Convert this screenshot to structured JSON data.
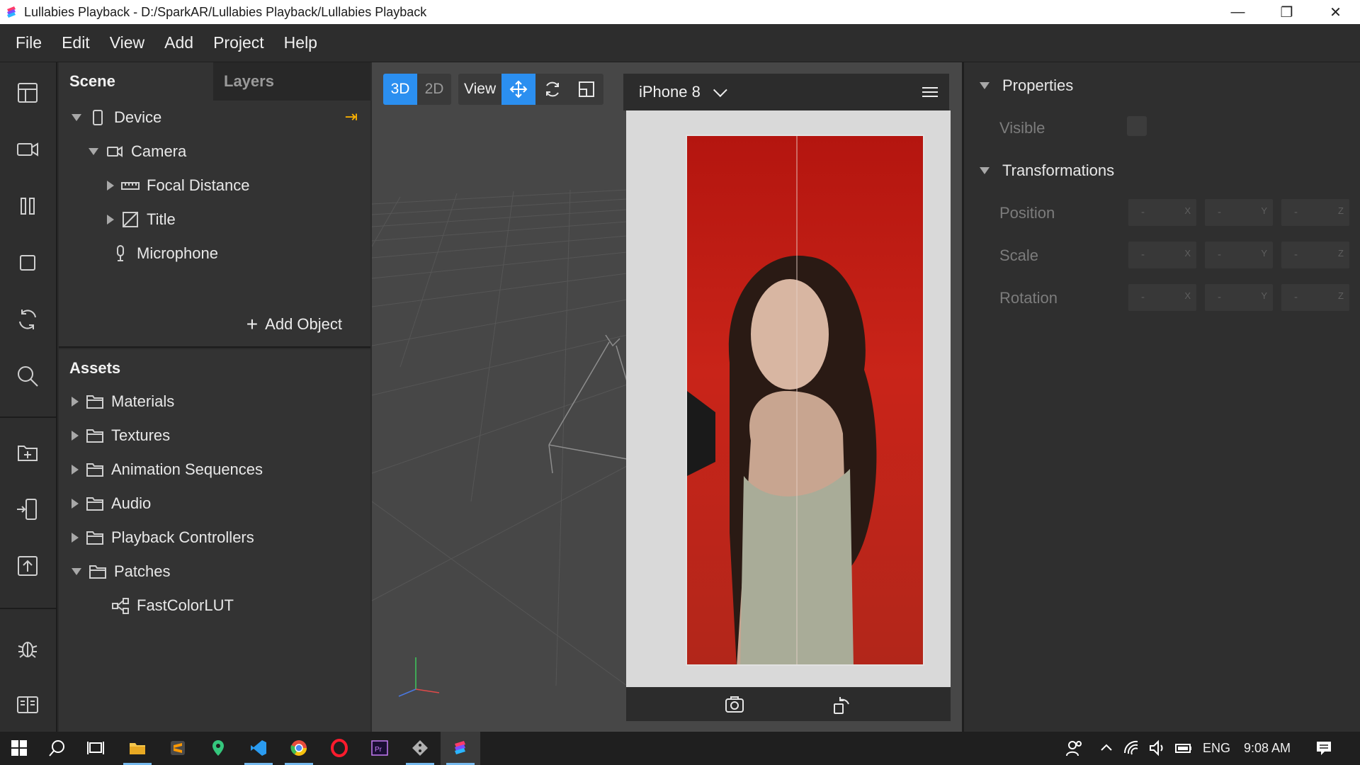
{
  "window": {
    "title": "Lullabies Playback - D:/SparkAR/Lullabies Playback/Lullabies Playback",
    "minimize_icon": "minimize-icon",
    "maximize_icon": "restore-icon",
    "close_icon": "close-icon"
  },
  "menu": [
    "File",
    "Edit",
    "View",
    "Add",
    "Project",
    "Help"
  ],
  "scene": {
    "tabs": {
      "scene": "Scene",
      "layers": "Layers"
    },
    "tree": [
      {
        "label": "Device",
        "icon": "phone-icon",
        "expanded": true
      },
      {
        "label": "Camera",
        "icon": "camera-icon",
        "expanded": true
      },
      {
        "label": "Focal Distance",
        "icon": "ruler-icon",
        "expanded": false
      },
      {
        "label": "Title",
        "icon": "canvas-icon",
        "expanded": false
      },
      {
        "label": "Microphone",
        "icon": "microphone-icon",
        "expanded": null
      }
    ],
    "add_object": "Add Object"
  },
  "assets": {
    "title": "Assets",
    "items": [
      {
        "label": "Materials",
        "icon": "folder-icon"
      },
      {
        "label": "Textures",
        "icon": "folder-icon"
      },
      {
        "label": "Animation Sequences",
        "icon": "folder-icon"
      },
      {
        "label": "Audio",
        "icon": "folder-icon"
      },
      {
        "label": "Playback Controllers",
        "icon": "folder-icon"
      },
      {
        "label": "Patches",
        "icon": "folder-icon"
      },
      {
        "label": "FastColorLUT",
        "icon": "patch-graph-icon"
      }
    ]
  },
  "viewport": {
    "mode_3d": "3D",
    "mode_2d": "2D",
    "view_label": "View",
    "device": "iPhone 8"
  },
  "properties": {
    "section_properties": "Properties",
    "visible_label": "Visible",
    "section_transformations": "Transformations",
    "rows": [
      {
        "label": "Position",
        "x": "-",
        "y": "-",
        "z": "-"
      },
      {
        "label": "Scale",
        "x": "-",
        "y": "-",
        "z": "-"
      },
      {
        "label": "Rotation",
        "x": "-",
        "y": "-",
        "z": "-"
      }
    ],
    "axis_x": "X",
    "axis_y": "Y",
    "axis_z": "Z"
  },
  "taskbar": {
    "language": "ENG",
    "time": "9:08 AM"
  },
  "colors": {
    "accent": "#2b8ff0",
    "pin_arrow": "#ffb400",
    "photo_red": "#c21d14"
  }
}
